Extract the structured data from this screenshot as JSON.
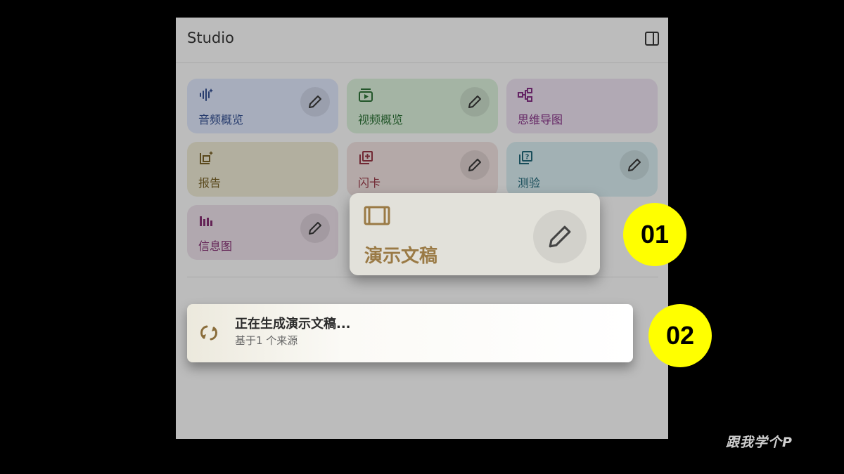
{
  "panel": {
    "title": "Studio",
    "layout_icon": "split-panel-icon"
  },
  "tiles": [
    {
      "label": "音频概览",
      "icon": "audio-waveform-icon",
      "bg": "#ccd3e6",
      "fg": "#304a86",
      "editable": true
    },
    {
      "label": "视频概览",
      "icon": "video-play-icon",
      "bg": "#c9dcc9",
      "fg": "#2b6a34",
      "editable": true
    },
    {
      "label": "思维导图",
      "icon": "mind-map-icon",
      "bg": "#d8cfdc",
      "fg": "#7a2d7a",
      "editable": false
    },
    {
      "label": "报告",
      "icon": "report-sparkle-icon",
      "bg": "#d9d6c2",
      "fg": "#6e5a24",
      "editable": false
    },
    {
      "label": "闪卡",
      "icon": "flashcard-icon",
      "bg": "#dccfcd",
      "fg": "#8a3340",
      "editable": true
    },
    {
      "label": "测验",
      "icon": "quiz-icon",
      "bg": "#c6d8dc",
      "fg": "#1f5f6e",
      "editable": true
    },
    {
      "label": "信息图",
      "icon": "infographic-bars-icon",
      "bg": "#d8cdd6",
      "fg": "#7a2d6a",
      "editable": true
    }
  ],
  "popup": {
    "label": "演示文稿",
    "icon": "slides-icon",
    "color": "#9a7a45"
  },
  "generating": {
    "title": "正在生成演示文稿...",
    "subtitle": "基于1 个来源",
    "icon": "sync-icon"
  },
  "badges": [
    "01",
    "02"
  ],
  "watermark": "跟我学个P",
  "colors": {
    "badge": "#ffff00",
    "background": "#000000"
  }
}
